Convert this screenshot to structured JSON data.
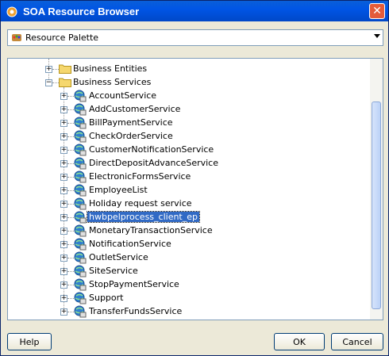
{
  "window": {
    "title": "SOA Resource Browser",
    "close_label": "✕"
  },
  "palette": {
    "label": "Resource Palette"
  },
  "tree": {
    "folders": [
      {
        "label": "Business Entities",
        "expanded": false
      },
      {
        "label": "Business Services",
        "expanded": true
      }
    ],
    "services": [
      "AccountService",
      "AddCustomerService",
      "BillPaymentService",
      "CheckOrderService",
      "CustomerNotificationService",
      "DirectDepositAdvanceService",
      "ElectronicFormsService",
      "EmployeeList",
      "Holiday request service",
      "hwbpelprocess_client_ep",
      "MonetaryTransactionService",
      "NotificationService",
      "OutletService",
      "SiteService",
      "StopPaymentService",
      "Support",
      "TransferFundsService"
    ],
    "selected_index": 9
  },
  "buttons": {
    "help": "Help",
    "ok": "OK",
    "cancel": "Cancel"
  },
  "colors": {
    "titlebar": "#0055e5",
    "selection": "#316ac5",
    "folder": "#f5d76e"
  }
}
